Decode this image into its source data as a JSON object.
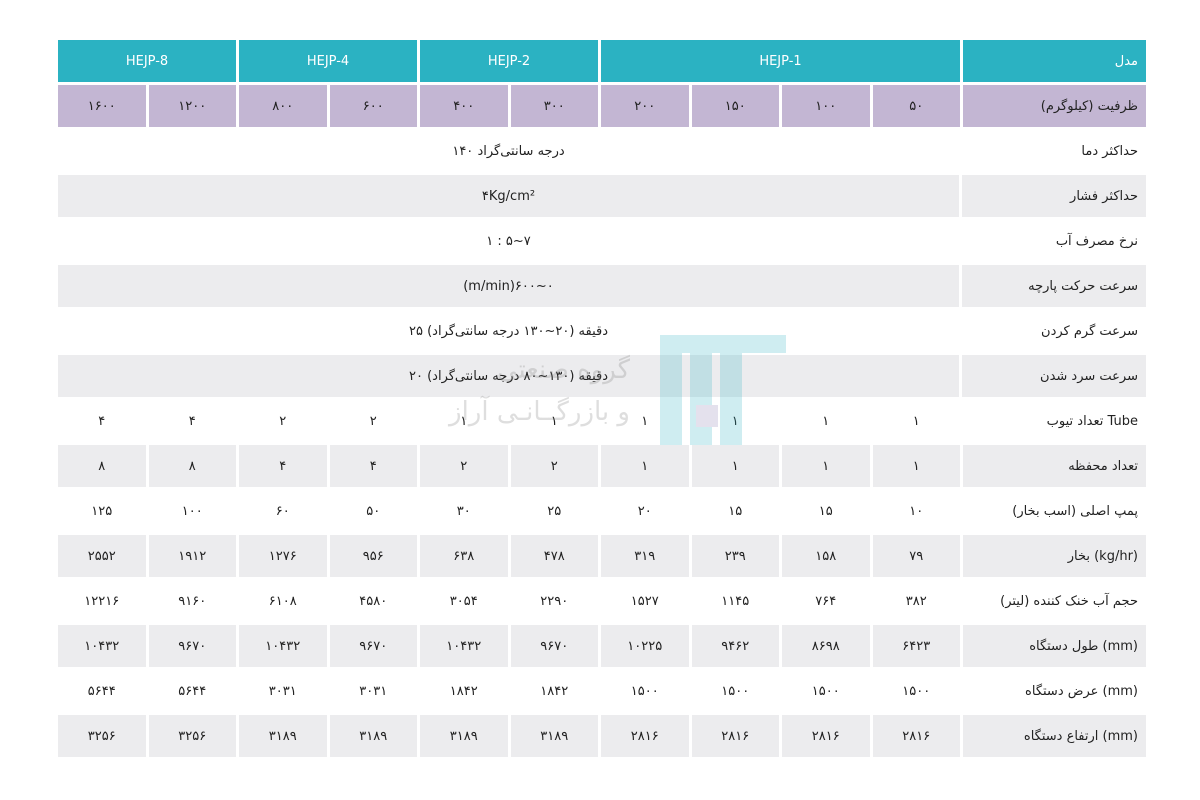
{
  "table": {
    "header": {
      "label": "مدل",
      "groups": [
        "HEJP-1",
        "HEJP-2",
        "HEJP-4",
        "HEJP-8"
      ]
    },
    "capacity": {
      "label": "ظرفیت (کیلوگرم)",
      "values": [
        "۵۰",
        "۱۰۰",
        "۱۵۰",
        "۲۰۰",
        "۳۰۰",
        "۴۰۰",
        "۶۰۰",
        "۸۰۰",
        "۱۲۰۰",
        "۱۶۰۰"
      ]
    },
    "max_temp": {
      "label": "حداکثر دما",
      "value": "۱۴۰ درجه سانتی‌گراد"
    },
    "max_pressure": {
      "label": "حداکثر فشار",
      "value": "۴Kg/cm²"
    },
    "water_rate": {
      "label": "نرخ مصرف آب",
      "value": "۱ : ۵~۷"
    },
    "fabric_speed": {
      "label": "سرعت حرکت پارچه",
      "value": "(m/min)۶۰۰~۰"
    },
    "heating_speed": {
      "label": "سرعت گرم کردن",
      "value": "۲۵ دقیقه (۲۰~۱۳۰ درجه سانتی‌گراد)"
    },
    "cooling_speed": {
      "label": "سرعت سرد شدن",
      "value": "۲۰ دقیقه (۱۳۰~۸۰ درجه سانتی‌گراد)"
    },
    "tubes": {
      "label": "تعداد تیوب Tube",
      "values": [
        "۱",
        "۱",
        "۱",
        "۱",
        "۱",
        "۱",
        "۲",
        "۲",
        "۴",
        "۴"
      ]
    },
    "chambers": {
      "label": "تعداد محفظه",
      "values": [
        "۱",
        "۱",
        "۱",
        "۱",
        "۲",
        "۲",
        "۴",
        "۴",
        "۸",
        "۸"
      ]
    },
    "main_pump": {
      "label": "پمپ اصلی (اسب بخار)",
      "values": [
        "۱۰",
        "۱۵",
        "۱۵",
        "۲۰",
        "۲۵",
        "۳۰",
        "۵۰",
        "۶۰",
        "۱۰۰",
        "۱۲۵"
      ]
    },
    "steam": {
      "label": "بخار (kg/hr)",
      "values": [
        "۷۹",
        "۱۵۸",
        "۲۳۹",
        "۳۱۹",
        "۴۷۸",
        "۶۳۸",
        "۹۵۶",
        "۱۲۷۶",
        "۱۹۱۲",
        "۲۵۵۲"
      ]
    },
    "cooling_water": {
      "label": "حجم آب خنک کننده (لیتر)",
      "values": [
        "۳۸۲",
        "۷۶۴",
        "۱۱۴۵",
        "۱۵۲۷",
        "۲۲۹۰",
        "۳۰۵۴",
        "۴۵۸۰",
        "۶۱۰۸",
        "۹۱۶۰",
        "۱۲۲۱۶"
      ]
    },
    "length": {
      "label": "طول دستگاه (mm)",
      "values": [
        "۶۴۲۳",
        "۸۶۹۸",
        "۹۴۶۲",
        "۱۰۲۲۵",
        "۹۶۷۰",
        "۱۰۴۳۲",
        "۹۶۷۰",
        "۱۰۴۳۲",
        "۹۶۷۰",
        "۱۰۴۳۲"
      ]
    },
    "width": {
      "label": "عرض دستگاه (mm)",
      "values": [
        "۱۵۰۰",
        "۱۵۰۰",
        "۱۵۰۰",
        "۱۵۰۰",
        "۱۸۴۲",
        "۱۸۴۲",
        "۳۰۳۱",
        "۳۰۳۱",
        "۵۶۴۴",
        "۵۶۴۴"
      ]
    },
    "height": {
      "label": "ارتفاع دستگاه (mm)",
      "values": [
        "۲۸۱۶",
        "۲۸۱۶",
        "۲۸۱۶",
        "۲۸۱۶",
        "۳۱۸۹",
        "۳۱۸۹",
        "۳۱۸۹",
        "۳۱۸۹",
        "۳۲۵۶",
        "۳۲۵۶"
      ]
    }
  },
  "watermark": {
    "line1": "گروه صنعتی",
    "line2": "و بازرگــانـی آراز"
  },
  "colors": {
    "header_bg": "#2bb2c2",
    "capacity_bg": "#c3b6d3",
    "stripe_bg": "#ececee"
  }
}
